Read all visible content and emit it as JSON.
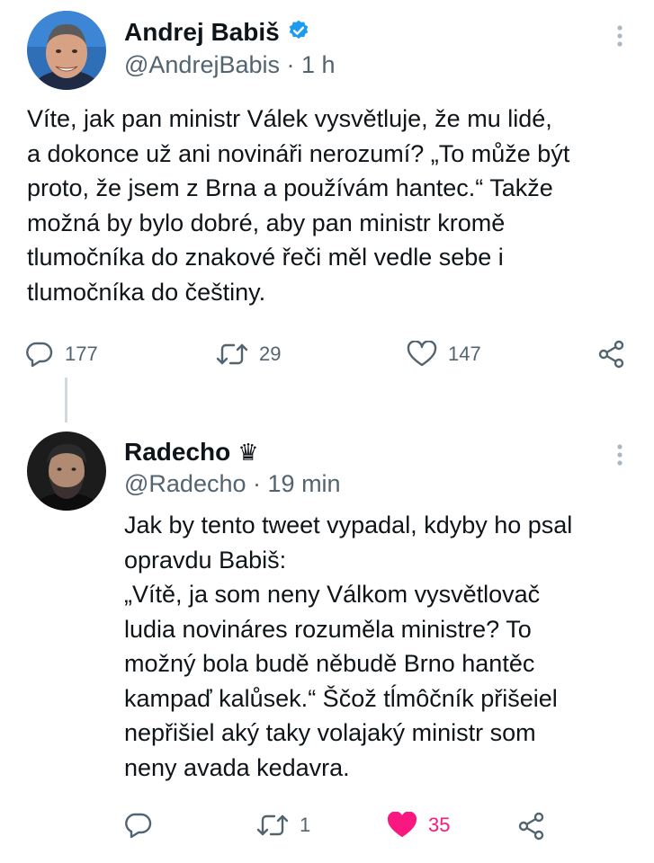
{
  "tweets": [
    {
      "display_name": "Andrej Babiš",
      "verified": true,
      "handle": "@AndrejBabis",
      "time": "1 h",
      "text_lines": [
        "Víte, jak pan ministr Válek vysvětluje, že mu lidé,",
        "a dokonce už ani novináři nerozumí? „To může být",
        "proto, že jsem z Brna a používám hantec.“ Takže",
        "možná by bylo dobré, aby pan ministr kromě",
        "tlumočníka do znakové řeči měl vedle sebe i",
        "tlumočníka do češtiny."
      ],
      "replies": "177",
      "retweets": "29",
      "likes": "147",
      "liked": false
    },
    {
      "display_name": "Radecho",
      "name_emoji": "♛",
      "handle": "@Radecho",
      "time": "19 min",
      "text_lines": [
        "Jak by tento tweet vypadal, kdyby ho psal",
        "opravdu Babiš:",
        "„Vítě, ja som neny Válkom vysvětlovač",
        "ludia novináres rozuměla ministre? To",
        "možný bola budě něbudě Brno hantěc",
        "kampaď kalůsek.“ Ščož tĺmôčník přišeiel",
        "nepřišiel aký taky volajaký ministr som",
        "neny avada kedavra."
      ],
      "replies": "",
      "retweets": "1",
      "likes": "35",
      "liked": true
    }
  ],
  "separator": "·",
  "icons": {
    "reply": "reply-icon",
    "retweet": "retweet-icon",
    "like": "heart-icon",
    "share": "share-icon",
    "more": "more-vertical-icon",
    "verified": "verified-badge-icon"
  },
  "colors": {
    "verified": "#1d9bf0",
    "like_active": "#f91880",
    "muted": "#536471",
    "text": "#0f1419"
  }
}
